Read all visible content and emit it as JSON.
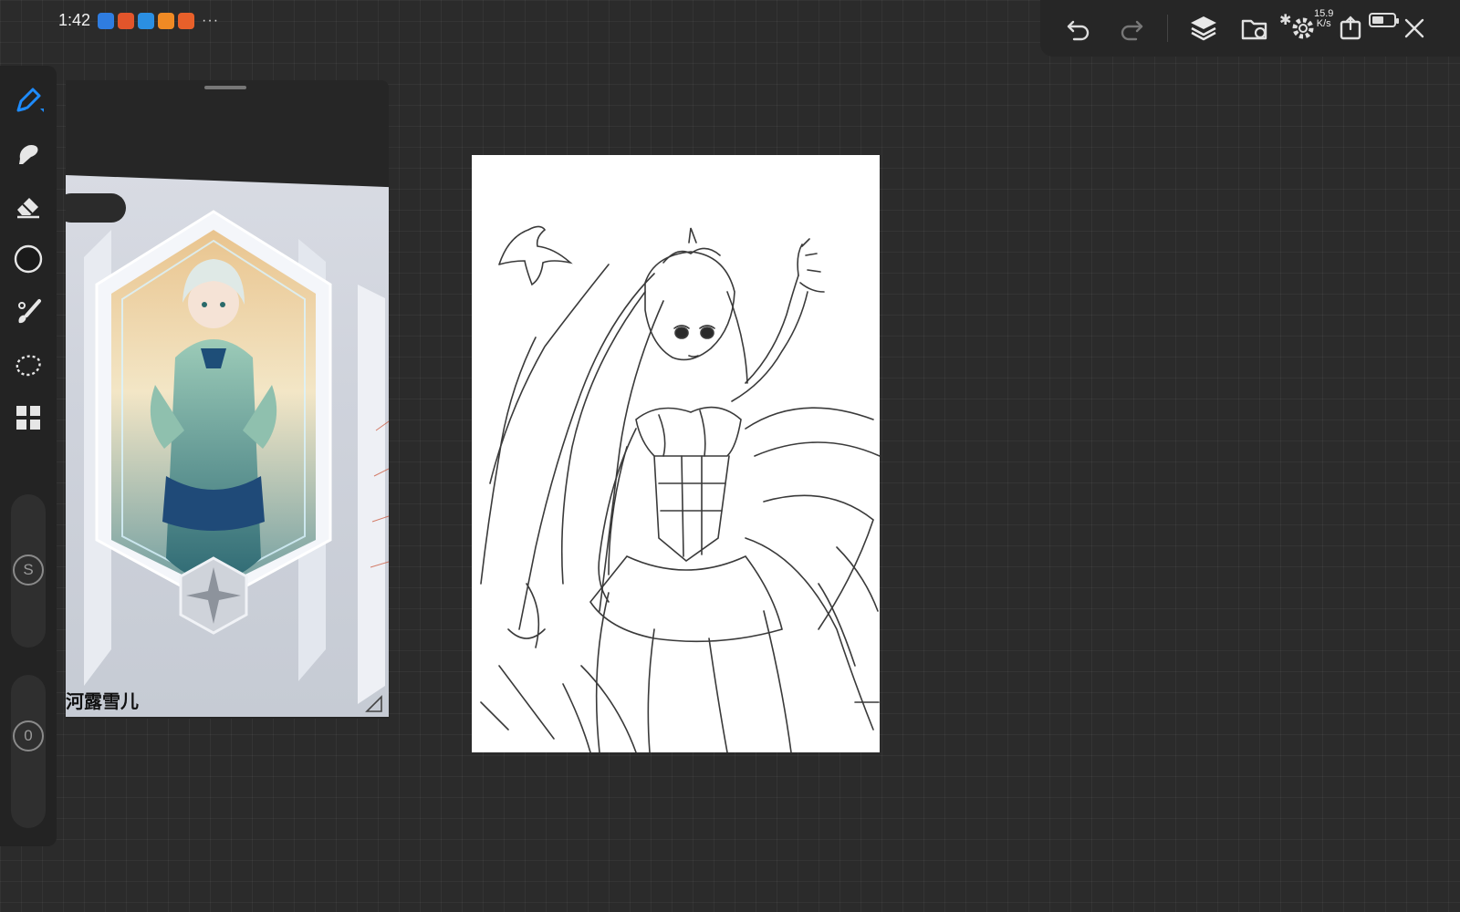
{
  "status_bar": {
    "time": "1:42",
    "notification_icons": [
      {
        "name": "cloud-app-icon",
        "color": "#2f7de1"
      },
      {
        "name": "game-app-icon",
        "color": "#e2552b"
      },
      {
        "name": "files-app-icon",
        "color": "#2b8fe3"
      },
      {
        "name": "video-app-icon",
        "color": "#f08a24"
      },
      {
        "name": "tools-app-icon",
        "color": "#e8602a"
      }
    ],
    "more": "···",
    "network_speed": "15.9",
    "network_unit": "K/s",
    "battery_level": 0.55
  },
  "toolbar": {
    "buttons": [
      "undo-icon",
      "redo-icon",
      "layers-icon",
      "import-folder-icon",
      "settings-icon",
      "export-icon",
      "close-icon"
    ]
  },
  "tools": [
    "pen-icon",
    "smudge-icon",
    "eraser-icon",
    "color-swatch-icon",
    "brush-icon",
    "lasso-icon",
    "grid-icon"
  ],
  "tool_colors": {
    "active": "#1e8cff",
    "inactive": "#e6e6e6",
    "current_color": "#1a1a1a"
  },
  "sliders": {
    "size": {
      "label": "S"
    },
    "opacity": {
      "label": "0"
    }
  },
  "reference": {
    "caption": "河露雪儿"
  }
}
